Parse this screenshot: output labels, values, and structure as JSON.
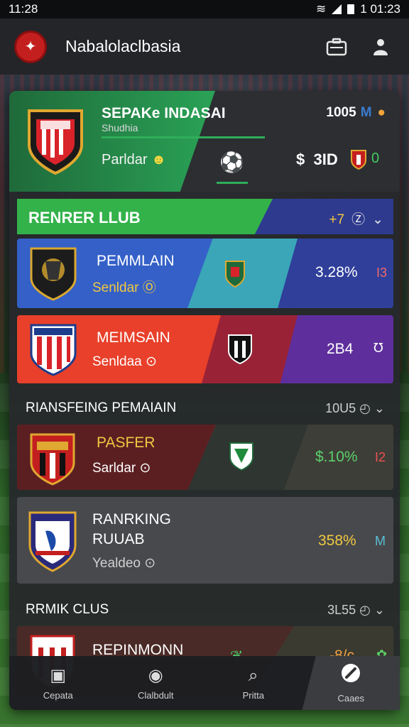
{
  "status": {
    "left_time": "11:28",
    "right_time": "1 01:23"
  },
  "appbar": {
    "title": "Nabalolaclbasia",
    "logo_icon": "club-logo-icon",
    "icons": [
      "briefcase-icon",
      "person-icon"
    ]
  },
  "hero": {
    "title": "SEPAKe INDASAI",
    "subtitle": "Shudhia",
    "label": "Parldar",
    "label_badge": "☻",
    "stat_value": "1005",
    "stat_badge": "M",
    "money_symbol": "$",
    "money_value": "3ID",
    "count": "0"
  },
  "club_header": {
    "title": "RENRER LLUB",
    "right_stat": "+7",
    "right_badge": "Ⓩ"
  },
  "rows": [
    {
      "name": "PEMMLAIN",
      "sub": "Senldar",
      "sub_badge": "Ⓞ",
      "value": "3.28%",
      "tag": "I3"
    },
    {
      "name": "MEIMSAIN",
      "sub": "Senldaa",
      "sub_badge": "⊙",
      "value": "2B4",
      "tag": "℧"
    }
  ],
  "section1": {
    "title": "RIANSFEING PEMAIAIN",
    "right": "10U5"
  },
  "rows2": [
    {
      "name": "PASFER",
      "sub": "Sarldar",
      "sub_badge": "⊙",
      "value": "$.10%",
      "tag": "I2"
    },
    {
      "name1": "RANRKING",
      "name2": "RUUAB",
      "sub": "Yealdeo",
      "sub_badge": "⊙",
      "value": "358%",
      "tag": "M"
    }
  ],
  "section2": {
    "title": "RRMIK CLUS",
    "right": "3L55"
  },
  "row3": {
    "name": "REPINMONN",
    "value": "-8/c",
    "tag": "✿"
  },
  "nav": [
    {
      "label": "Cepata",
      "icon": "square-icon"
    },
    {
      "label": "Clalbdult",
      "icon": "circle-icon"
    },
    {
      "label": "Pritta",
      "icon": "search-icon"
    },
    {
      "label": "Caaes",
      "icon": "whistle-icon"
    }
  ],
  "colors": {
    "green": "#2aa256",
    "blue": "#3560c8",
    "red": "#e8402a",
    "purple": "#5e2f9c",
    "gold": "#f0c840"
  }
}
